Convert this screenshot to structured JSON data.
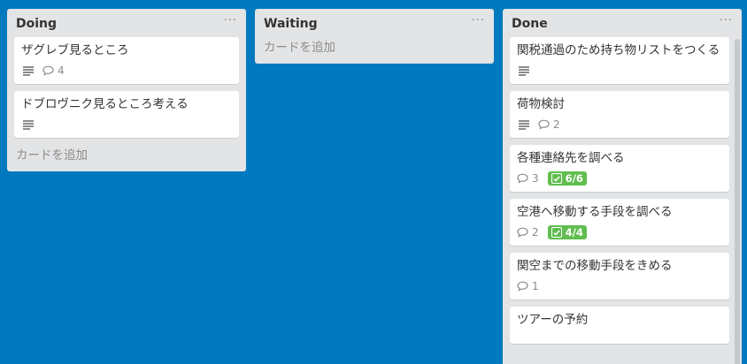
{
  "lists": [
    {
      "title": "Doing",
      "menu": "···",
      "cards": [
        {
          "title": "ザグレブ見るところ",
          "description_icon": "description-icon",
          "comments": "4"
        },
        {
          "title": "ドブロヴニク見るところ考える",
          "description_icon": "description-icon"
        }
      ],
      "add_label": "カードを追加"
    },
    {
      "title": "Waiting",
      "menu": "···",
      "cards": [],
      "add_label": "カードを追加"
    },
    {
      "title": "Done",
      "menu": "···",
      "cards": [
        {
          "title": "関税通過のため持ち物リストをつくる",
          "description_icon": "description-icon"
        },
        {
          "title": "荷物検討",
          "description_icon": "description-icon",
          "comments": "2"
        },
        {
          "title": "各種連絡先を調べる",
          "comments": "3",
          "checklist": "6/6"
        },
        {
          "title": "空港へ移動する手段を調べる",
          "comments": "2",
          "checklist": "4/4"
        },
        {
          "title": "関空までの移動手段をきめる",
          "comments": "1"
        },
        {
          "title": "ツアーの予約"
        }
      ]
    }
  ],
  "colors": {
    "board_background": "#0079bf",
    "list_background": "#e2e4e6",
    "checklist_complete": "#61bd4f"
  }
}
